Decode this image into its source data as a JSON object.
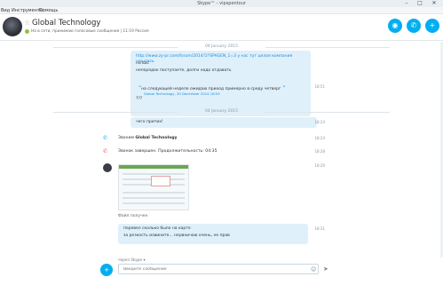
{
  "window": {
    "title": "Skype™ - vipspentour",
    "min_glyph": "–",
    "max_glyph": "□",
    "close_glyph": "✕"
  },
  "menu": {
    "items": [
      "Вид",
      "Инструменты",
      "Помощь"
    ]
  },
  "header": {
    "contact_name": "Global Technology",
    "star_glyph": "☆",
    "status_line": "На в сети, принимаю голосовые сообщения | 11:19 Россия",
    "video_call_glyph": "◉",
    "call_glyph": "✆",
    "add_glyph": "+"
  },
  "conversation": {
    "date1": "04 January 2015",
    "msg1_line1": "http://www.zy-pr.com/forum/2014?2?SPAGEN_1=3 у нас тут целая компания нашлась",
    "msg1_line2": "на вас",
    "msg1_line3": "непорядок поступаете, долги надо отдавать",
    "quote_text": "на следующей неделе ожидаю приход примерно в среду четверг",
    "quote_meta": "Global Technology, 30 December 2014 18:55",
    "quote_tail": "???",
    "quote_time": "18:51",
    "date2": "04 January 2015",
    "msg2_text": "чего притих!",
    "msg2_time": "18:24",
    "call_text_prefix": "Звоним",
    "call_text_name": "Global Technology",
    "call_time": "18:24",
    "call_end_text": "Звонок завершен. Продолжительность: 04:35",
    "call_end_time": "18:28",
    "image_time": "18:29",
    "file_received": "Файл получен",
    "msg3_line1": "перевел сколько было на карте",
    "msg3_line2": "за резкость извините... нервничаю очень, не прав",
    "msg3_time": "18:31"
  },
  "composer": {
    "via": "через Skype ▾",
    "placeholder": "Введите сообщение",
    "emoji_glyph": "☺",
    "send_glyph": "➤",
    "attach_glyph": "+"
  },
  "colors": {
    "accent": "#00aff0",
    "bubble": "#dff0fb",
    "online": "#8dc63f"
  }
}
